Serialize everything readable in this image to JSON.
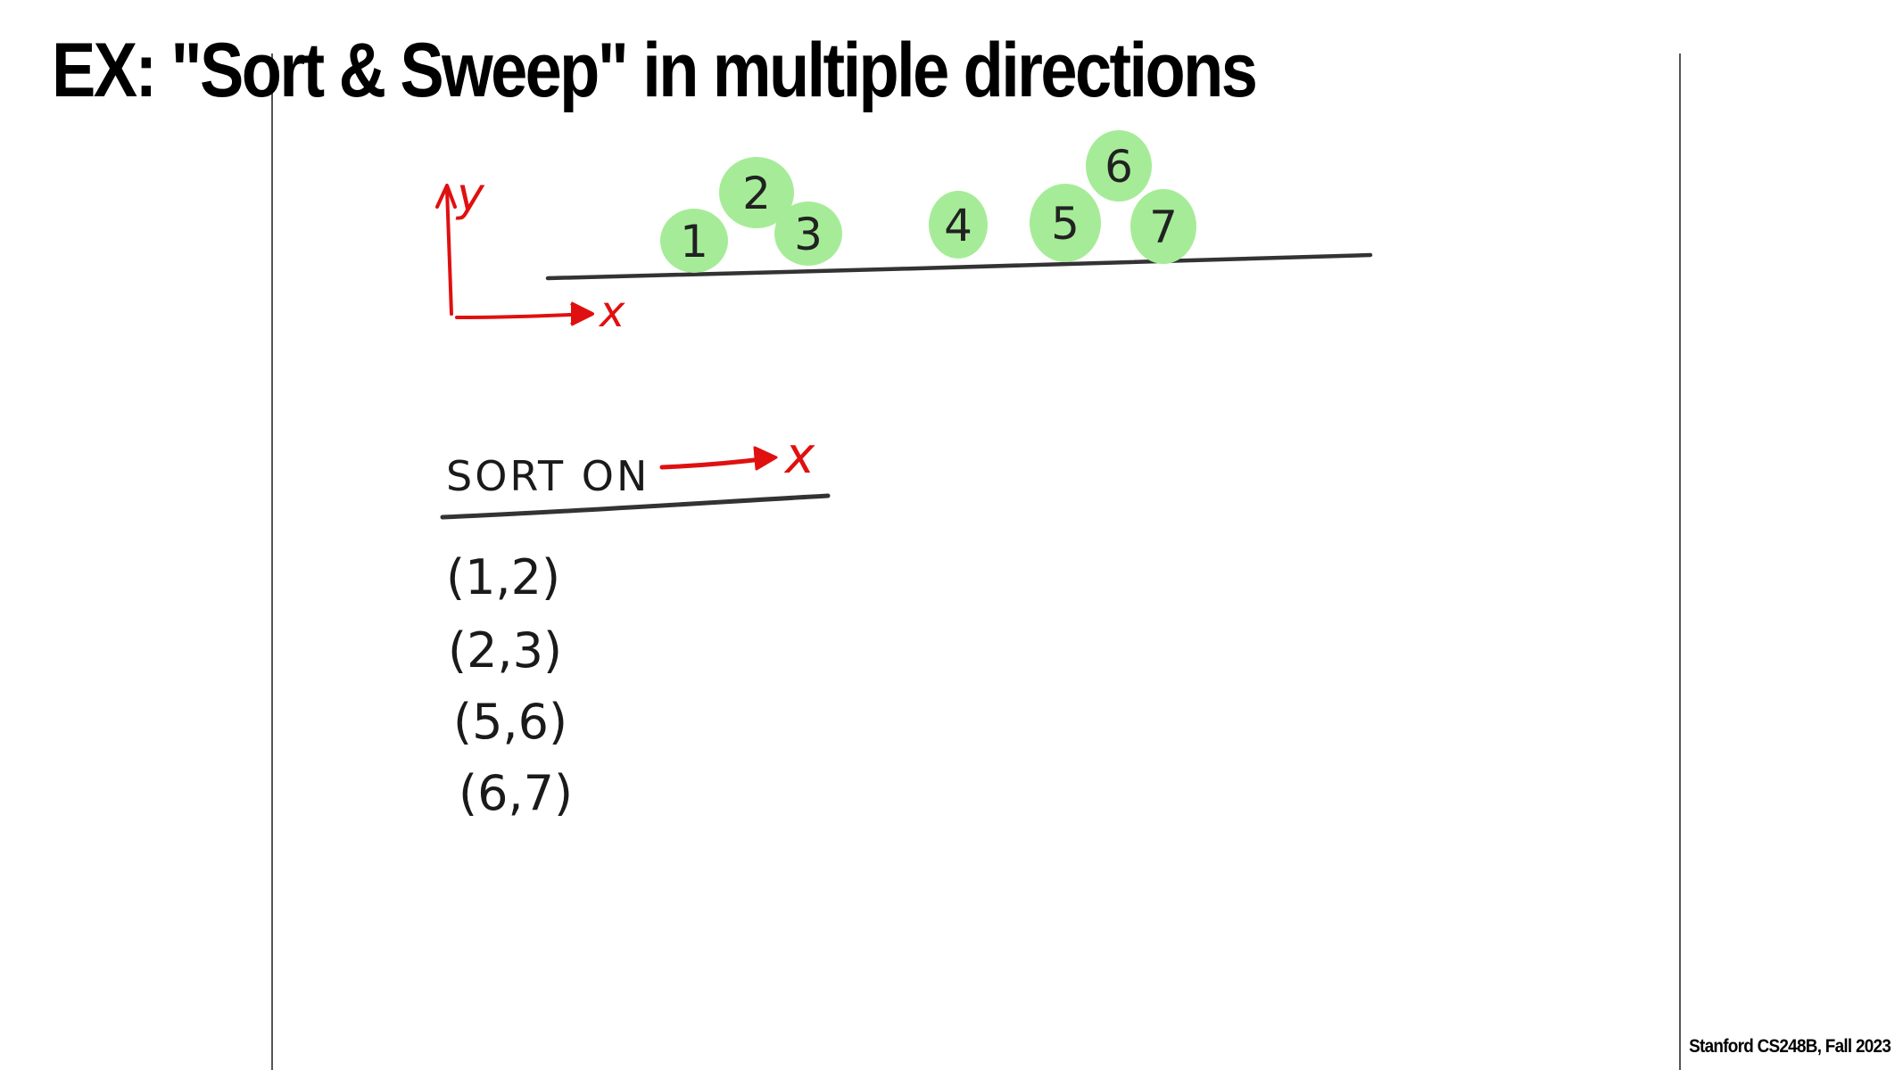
{
  "slide": {
    "title": "EX: \"Sort & Sweep\" in multiple directions",
    "footer": "Stanford CS248B, Fall 2023"
  },
  "axes": {
    "y_label": "y",
    "x_label": "x",
    "color": "#e01010"
  },
  "objects": {
    "fill": "#a6ec98",
    "labels": [
      "1",
      "2",
      "3",
      "4",
      "5",
      "6",
      "7"
    ]
  },
  "sort_heading": {
    "text": "SORT ON",
    "target": "x"
  },
  "pairs": [
    "(1,2)",
    "(2,3)",
    "(5,6)",
    "(6,7)"
  ]
}
